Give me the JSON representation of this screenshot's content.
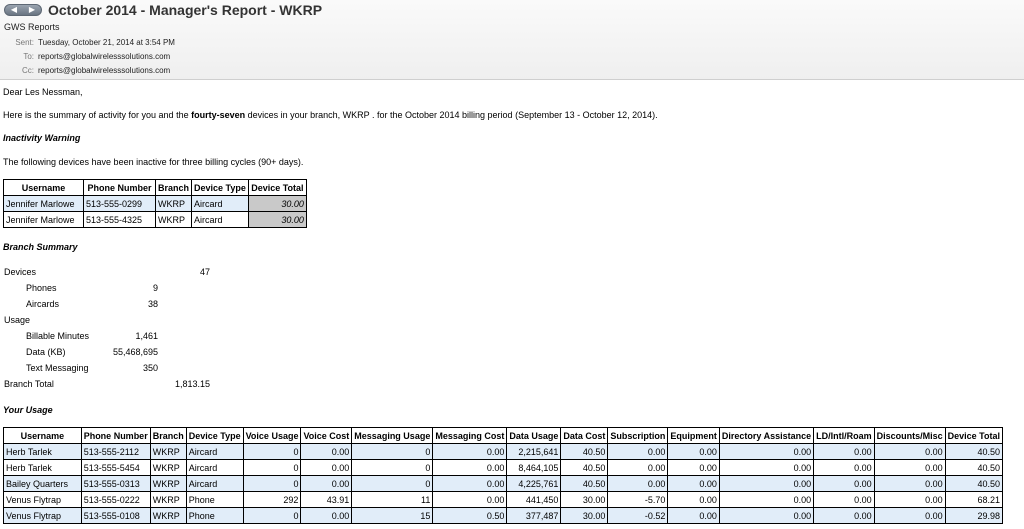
{
  "header": {
    "nav_back": "◀",
    "nav_forward": "▶",
    "subject": "October 2014 - Manager's Report - WKRP",
    "from": "GWS Reports",
    "sent_label": "Sent:",
    "sent_value": "Tuesday, October 21, 2014 at 3:54 PM",
    "to_label": "To:",
    "to_value": "reports@globalwirelesssolutions.com",
    "cc_label": "Cc:",
    "cc_value": "reports@globalwirelesssolutions.com"
  },
  "body": {
    "greeting": "Dear Les Nessman,",
    "intro_pre": "Here is the summary of activity for you and the ",
    "intro_bold": "fourty-seven",
    "intro_post": " devices in your branch, WKRP . for the October 2014 billing period (September 13 - October 12, 2014).",
    "inactivity_heading": "Inactivity Warning",
    "inactivity_text": "The following devices have been inactive for three billing cycles (90+ days).",
    "branch_summary_heading": "Branch Summary",
    "your_usage_heading": "Your Usage"
  },
  "inactive_table": {
    "headers": [
      "Username",
      "Phone Number",
      "Branch",
      "Device Type",
      "Device Total"
    ],
    "rows": [
      [
        "Jennifer Marlowe",
        "513-555-0299",
        "WKRP",
        "Aircard",
        "30.00"
      ],
      [
        "Jennifer Marlowe",
        "513-555-4325",
        "WKRP",
        "Aircard",
        "30.00"
      ]
    ]
  },
  "branch_summary": {
    "devices_label": "Devices",
    "devices_value": "47",
    "phones_label": "Phones",
    "phones_value": "9",
    "aircards_label": "Aircards",
    "aircards_value": "38",
    "usage_label": "Usage",
    "minutes_label": "Billable Minutes",
    "minutes_value": "1,461",
    "data_label": "Data (KB)",
    "data_value": "55,468,695",
    "text_label": "Text Messaging",
    "text_value": "350",
    "total_label": "Branch Total",
    "total_value": "1,813.15"
  },
  "usage_table": {
    "headers": [
      "Username",
      "Phone Number",
      "Branch",
      "Device Type",
      "Voice Usage",
      "Voice Cost",
      "Messaging Usage",
      "Messaging Cost",
      "Data Usage",
      "Data Cost",
      "Subscription",
      "Equipment",
      "Directory Assistance",
      "LD/Intl/Roam",
      "Discounts/Misc",
      "Device Total"
    ],
    "rows": [
      [
        "Herb Tarlek",
        "513-555-2112",
        "WKRP",
        "Aircard",
        "0",
        "0.00",
        "0",
        "0.00",
        "2,215,641",
        "40.50",
        "0.00",
        "0.00",
        "0.00",
        "0.00",
        "0.00",
        "40.50"
      ],
      [
        "Herb Tarlek",
        "513-555-5454",
        "WKRP",
        "Aircard",
        "0",
        "0.00",
        "0",
        "0.00",
        "8,464,105",
        "40.50",
        "0.00",
        "0.00",
        "0.00",
        "0.00",
        "0.00",
        "40.50"
      ],
      [
        "Bailey Quarters",
        "513-555-0313",
        "WKRP",
        "Aircard",
        "0",
        "0.00",
        "0",
        "0.00",
        "4,225,761",
        "40.50",
        "0.00",
        "0.00",
        "0.00",
        "0.00",
        "0.00",
        "40.50"
      ],
      [
        "Venus Flytrap",
        "513-555-0222",
        "WKRP",
        "Phone",
        "292",
        "43.91",
        "11",
        "0.00",
        "441,450",
        "30.00",
        "-5.70",
        "0.00",
        "0.00",
        "0.00",
        "0.00",
        "68.21"
      ],
      [
        "Venus Flytrap",
        "513-555-0108",
        "WKRP",
        "Phone",
        "0",
        "0.00",
        "15",
        "0.50",
        "377,487",
        "30.00",
        "-0.52",
        "0.00",
        "0.00",
        "0.00",
        "0.00",
        "29.98"
      ]
    ]
  }
}
